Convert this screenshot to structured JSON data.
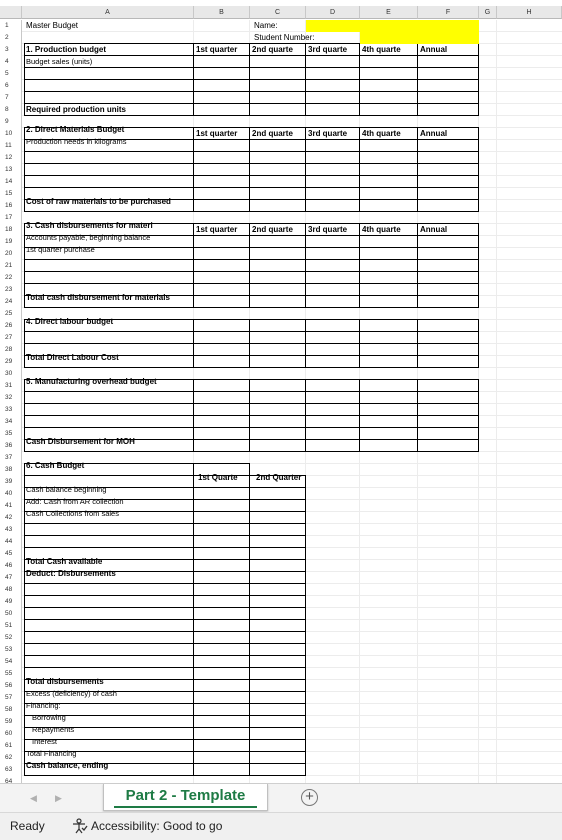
{
  "columns": [
    "A",
    "B",
    "C",
    "D",
    "E",
    "F",
    "G",
    "H"
  ],
  "rows": [
    1,
    2,
    3,
    4,
    5,
    6,
    7,
    8,
    9,
    10,
    11,
    12,
    13,
    14,
    15,
    16,
    17,
    18,
    19,
    20,
    21,
    22,
    23,
    24,
    25,
    26,
    27,
    28,
    29,
    30,
    31,
    32,
    33,
    34,
    35,
    36,
    37,
    38,
    39,
    40,
    41,
    42,
    43,
    44,
    45,
    46,
    47,
    48,
    49,
    50,
    51,
    52,
    53,
    54,
    55,
    56,
    57,
    58,
    59,
    60,
    61,
    62,
    63,
    64
  ],
  "header": {
    "master_budget": "Master Budget",
    "name_label": "Name:",
    "student_number_label": "Student Number:"
  },
  "quarters": [
    "1st quarter",
    "2nd quarte",
    "3rd quarte",
    "4th quarte",
    "Annual"
  ],
  "sections": {
    "production": {
      "title": "1. Production budget",
      "line1": "Budget sales (units)",
      "total": "Required production units"
    },
    "materials": {
      "title": "2. Direct Materials Budget",
      "line1": "Production needs in kilograms",
      "total": "Cost of raw materials to be purchased"
    },
    "cash_disb": {
      "title": "3. Cash disbursements for materi",
      "line1": "Accounts payable, beginning balance",
      "line2": "1st quarter purchase",
      "total": "Total cash disbursement for materials"
    },
    "labour": {
      "title": "4. Direct labour budget",
      "total": "Total Direct Labour Cost"
    },
    "moh": {
      "title": "5. Manufacturing overhead budget",
      "total": "Cash Disbursement for MOH"
    },
    "cash_budget": {
      "title": "6. Cash Budget",
      "q1": "1st Quarte",
      "q2": "2nd Quarter",
      "cash_beginning": "Cash balance beginning",
      "ar_collection": "Add:  Cash from AR collection",
      "collections_sales": "Cash Collections from sales",
      "total_available": "Total Cash available",
      "deduct": "Deduct: Disbursements",
      "total_disb": "Total disbursements",
      "excess": "Excess (deficiency) of cash",
      "financing": "Financing:",
      "borrowing": "Borrowing",
      "repayments": "Repayments",
      "interest": "Interest",
      "total_financing": "Total Financing",
      "ending": "Cash balance, ending"
    }
  },
  "tabs": {
    "active": "Part 2 - Template"
  },
  "status": {
    "ready": "Ready",
    "accessibility": "Accessibility: Good to go"
  }
}
